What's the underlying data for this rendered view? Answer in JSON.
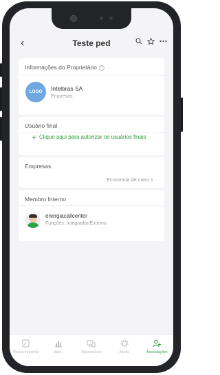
{
  "header": {
    "title": "Teste ped",
    "back_glyph": "‹",
    "icons": [
      "search-icon",
      "star-icon",
      "more-icon"
    ]
  },
  "owner": {
    "heading": "Informações do Proprietário",
    "logo_text": "LOGO",
    "name": "Intelbras SA",
    "subtitle": "Empresas"
  },
  "end_user": {
    "heading": "Usuário final",
    "add_text": "Clique aqui para autorizar os usuários finais"
  },
  "companies": {
    "heading": "Empresas",
    "value": "Economia de calor s"
  },
  "internal_member": {
    "heading": "Membro Interno",
    "name": "energiacallcenter",
    "roles": "Funções: Integrador/Externo"
  },
  "tabbar": {
    "tabs": [
      {
        "label": "Planta inquérito",
        "icon": "floor-plan-icon",
        "active": false
      },
      {
        "label": "dad...",
        "icon": "bar-chart-icon",
        "active": false
      },
      {
        "label": "Dispositivos",
        "icon": "devices-icon",
        "active": false
      },
      {
        "label": "Alerta",
        "icon": "gear-icon",
        "active": false
      },
      {
        "label": "Associações",
        "icon": "people-icon",
        "active": true
      }
    ]
  },
  "colors": {
    "accent": "#2a9d3c",
    "logo_bg": "#6fa7e0",
    "background": "#f4f4f6"
  }
}
